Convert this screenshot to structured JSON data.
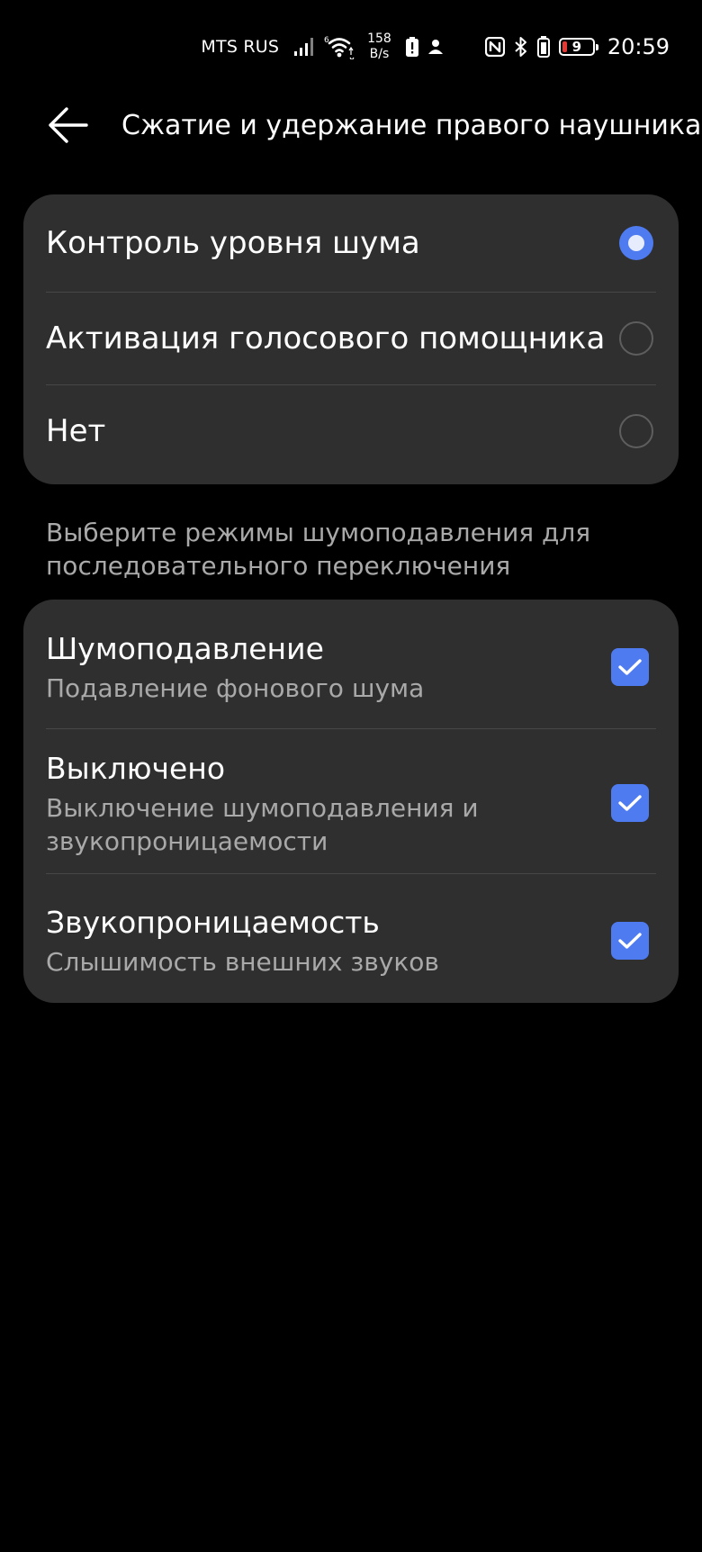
{
  "status_bar": {
    "carrier": "MTS RUS",
    "net_speed_value": "158",
    "net_speed_unit": "B/s",
    "battery_level": "9",
    "time": "20:59"
  },
  "header": {
    "title": "Сжатие и удержание правого наушника"
  },
  "action_options": [
    {
      "label": "Контроль уровня шума",
      "selected": true
    },
    {
      "label": "Активация голосового помощника",
      "selected": false
    },
    {
      "label": "Нет",
      "selected": false
    }
  ],
  "modes_caption": "Выберите режимы шумоподавления для последовательного переключения",
  "modes": [
    {
      "title": "Шумоподавление",
      "subtitle": "Подавление фонового шума",
      "checked": true
    },
    {
      "title": "Выключено",
      "subtitle": "Выключение шумоподавления и звукопроницаемости",
      "checked": true
    },
    {
      "title": "Звукопроницаемость",
      "subtitle": "Слышимость внешних звуков",
      "checked": true
    }
  ],
  "colors": {
    "background": "#000000",
    "card": "#2f2f2f",
    "accent": "#4f7bf0",
    "secondary_text": "#a9a9a9",
    "battery_low": "#e53935"
  },
  "icons": {
    "back": "arrow-left-icon",
    "signal": "cellular-signal-icon",
    "wifi": "wifi-icon",
    "battery_alert": "battery-alert-icon",
    "user": "person-icon",
    "nfc": "nfc-icon",
    "bluetooth": "bluetooth-icon",
    "earbuds_battery": "earbuds-battery-icon",
    "check": "check-icon"
  }
}
